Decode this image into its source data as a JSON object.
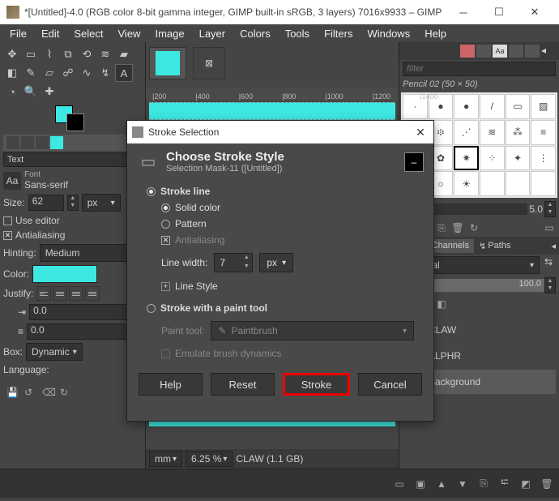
{
  "titlebar": {
    "text": "*[Untitled]-4.0 (RGB color 8-bit gamma integer, GIMP built-in sRGB, 3 layers) 7016x9933 – GIMP"
  },
  "menu": [
    "File",
    "Edit",
    "Select",
    "View",
    "Image",
    "Layer",
    "Colors",
    "Tools",
    "Filters",
    "Windows",
    "Help"
  ],
  "ruler_marks": [
    "|200",
    "|400",
    "|600",
    "|800",
    "|1000",
    "|1200",
    "|1400"
  ],
  "tooloptions": {
    "section": "Text",
    "font_label": "Font",
    "font_value": "Sans-serif",
    "size_label": "Size:",
    "size_value": "62",
    "size_unit": "px",
    "use_editor": "Use editor",
    "antialiasing": "Antialiasing",
    "hinting_label": "Hinting:",
    "hinting_value": "Medium",
    "color_label": "Color:",
    "justify_label": "Justify:",
    "indent_value": "0.0",
    "line_spacing": "0.0",
    "box_label": "Box:",
    "box_value": "Dynamic",
    "language_label": "Language:"
  },
  "right": {
    "filter_placeholder": "filter",
    "brush_name": "Pencil 02 (50 × 50)",
    "spacing_value": "5.0",
    "channels_tab": "Channels",
    "paths_tab": "Paths",
    "mode": "Normal",
    "opacity": "100.0",
    "layers": [
      {
        "name": "CLAW"
      },
      {
        "name": "ALPHR"
      },
      {
        "name": "Background"
      }
    ]
  },
  "status": {
    "unit": "mm",
    "zoom": "6.25 %",
    "info": "CLAW (1.1 GB)"
  },
  "dialog": {
    "title": "Stroke Selection",
    "heading": "Choose Stroke Style",
    "sub": "Selection Mask-11 ([Untitled])",
    "stroke_line": "Stroke line",
    "solid_color": "Solid color",
    "pattern": "Pattern",
    "antialiasing": "Antialiasing",
    "line_width_label": "Line width:",
    "line_width_value": "7",
    "line_width_unit": "px",
    "line_style": "Line Style",
    "stroke_paint": "Stroke with a paint tool",
    "paint_tool_label": "Paint tool:",
    "paint_tool_value": "Paintbrush",
    "emulate": "Emulate brush dynamics",
    "help": "Help",
    "reset": "Reset",
    "stroke": "Stroke",
    "cancel": "Cancel"
  }
}
